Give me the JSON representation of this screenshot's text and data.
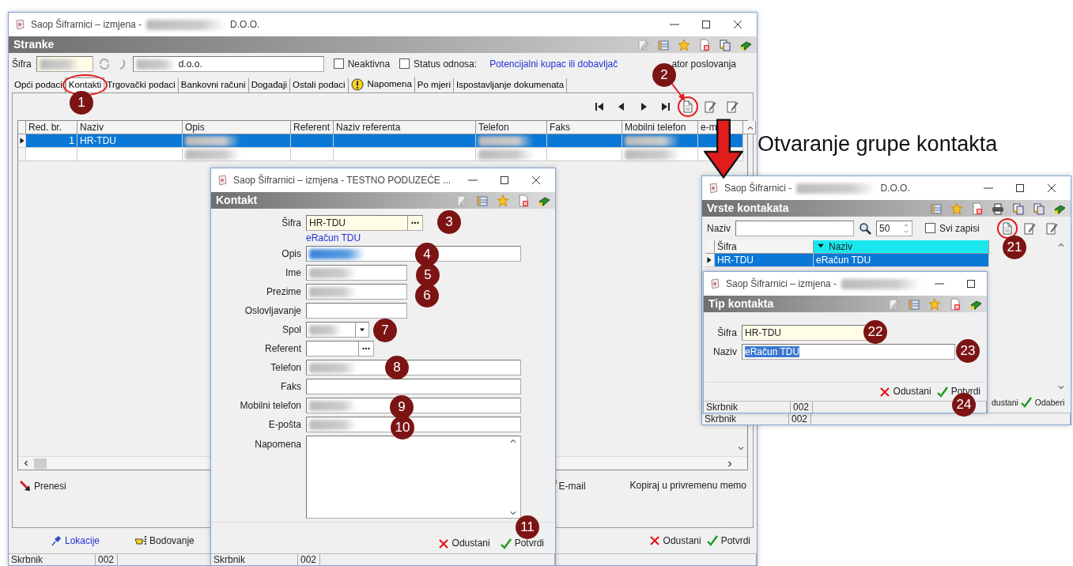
{
  "caption": "Otvaranje grupe kontakta",
  "annotations": [
    "1",
    "2",
    "3",
    "4",
    "5",
    "6",
    "7",
    "8",
    "9",
    "10",
    "11",
    "21",
    "22",
    "23",
    "24"
  ],
  "main": {
    "title": "Saop Šifrarnici – izmjena -",
    "title_end": "D.O.O.",
    "title_redacted": true,
    "panel": "Stranke",
    "sifra_label": "Šifra",
    "name_value": "d.o.o.",
    "checks": [
      {
        "label": "Neaktivna",
        "checked": false
      },
      {
        "label": "Status odnosa:",
        "checked": false
      }
    ],
    "status_link": "Potencijalni kupac ili dobavljač",
    "indicator": "ator poslovanja",
    "tabs": [
      {
        "label": "Opći podaci",
        "selected": false,
        "flagged": false
      },
      {
        "label": "Kontakti",
        "selected": true,
        "flagged": false
      },
      {
        "label": "Trgovački podaci",
        "selected": false,
        "flagged": false
      },
      {
        "label": "Bankovni računi",
        "selected": false,
        "flagged": false
      },
      {
        "label": "Događaji",
        "selected": false,
        "flagged": false
      },
      {
        "label": "Ostali podaci",
        "selected": false,
        "flagged": false
      },
      {
        "label": "Napomena",
        "selected": false,
        "flagged": true
      },
      {
        "label": "Po mjeri",
        "selected": false,
        "flagged": false
      },
      {
        "label": "Ispostavljanje dokumenata",
        "selected": false,
        "flagged": false
      }
    ],
    "columns": [
      "Red. br.",
      "Naziv",
      "Opis",
      "Referent",
      "Naziv referenta",
      "Telefon",
      "Faks",
      "Mobilni telefon",
      "e-m"
    ],
    "rows": [
      {
        "number": "1",
        "name": "HR-TDU",
        "selected": true
      },
      {
        "selected": false
      }
    ],
    "actions": [
      {
        "label": "Prenesi",
        "kind": "transfer"
      },
      {
        "label": "E-mail",
        "kind": "email"
      },
      {
        "label": "Kopiraj u privremenu memo",
        "kind": "plain"
      }
    ],
    "footer_links": [
      {
        "label": "Lokacije",
        "kind": "pin"
      },
      {
        "label": "Bodovanje",
        "kind": "hand"
      }
    ],
    "buttons": [
      {
        "label": "Odustani",
        "kind": "cancel"
      },
      {
        "label": "Potvrdi",
        "kind": "confirm"
      }
    ],
    "status": [
      "Skrbnik",
      "002"
    ]
  },
  "contact": {
    "title": "Saop Šifrarnici – izmjena  - TESTNO PODUZEĆE ...",
    "panel": "Kontakt",
    "fields": [
      {
        "label": "Šifra",
        "kind": "lookup",
        "value": "HR-TDU",
        "required": true,
        "redacted": false
      },
      {
        "kind": "note",
        "text": "eRačun TDU"
      },
      {
        "label": "Opis",
        "kind": "text",
        "required": false,
        "redacted": true
      },
      {
        "label": "Ime",
        "kind": "text",
        "required": false,
        "redacted": true
      },
      {
        "label": "Prezime",
        "kind": "text",
        "required": false,
        "redacted": true
      },
      {
        "label": "Oslovljavanje",
        "kind": "text",
        "required": false,
        "redacted": false
      },
      {
        "label": "Spol",
        "kind": "select",
        "required": false,
        "redacted": true
      },
      {
        "label": "Referent",
        "kind": "lookup",
        "required": false,
        "redacted": false
      },
      {
        "label": "Telefon",
        "kind": "text",
        "required": false,
        "redacted": true
      },
      {
        "label": "Faks",
        "kind": "text",
        "required": false,
        "redacted": false
      },
      {
        "label": "Mobilni telefon",
        "kind": "text",
        "required": false,
        "redacted": true
      },
      {
        "label": "E-pošta",
        "kind": "text",
        "required": false,
        "redacted": true
      },
      {
        "label": "Napomena",
        "kind": "memo",
        "required": false,
        "redacted": false
      }
    ],
    "buttons": [
      {
        "label": "Odustani",
        "kind": "cancel"
      },
      {
        "label": "Potvrdi",
        "kind": "confirm"
      }
    ],
    "status": [
      "Skrbnik",
      "002"
    ]
  },
  "types": {
    "title": "Saop Šifrarnici -",
    "title_end": "D.O.O.",
    "title_redacted": true,
    "panel": "Vrste kontakata",
    "search_label": "Naziv",
    "limit": "50",
    "show_all": {
      "label": "Svi zapisi",
      "checked": false
    },
    "columns": [
      {
        "label": "Šifra",
        "sorted": false
      },
      {
        "label": "Naziv",
        "sorted": true
      }
    ],
    "rows": [
      {
        "cells": [
          "HR-TDU",
          "eRačun TDU"
        ],
        "selected": true
      }
    ],
    "buttons": [
      {
        "label": "dustani",
        "kind": "plain"
      },
      {
        "label": "Odaberi",
        "kind": "confirm"
      }
    ],
    "status": [
      "Skrbnik",
      "002"
    ]
  },
  "type_dialog": {
    "title": "Saop Šifrarnici – izmjena -",
    "title_redacted": true,
    "panel": "Tip kontakta",
    "fields": [
      {
        "label": "Šifra",
        "value": "HR-TDU",
        "required": true,
        "text_selected": false
      },
      {
        "label": "Naziv",
        "value": "eRačun TDU",
        "required": false,
        "text_selected": true
      }
    ],
    "buttons": [
      {
        "label": "Odustani",
        "kind": "cancel"
      },
      {
        "label": "Potvrdi",
        "kind": "confirm"
      }
    ],
    "status": [
      "Skrbnik",
      "002"
    ]
  }
}
